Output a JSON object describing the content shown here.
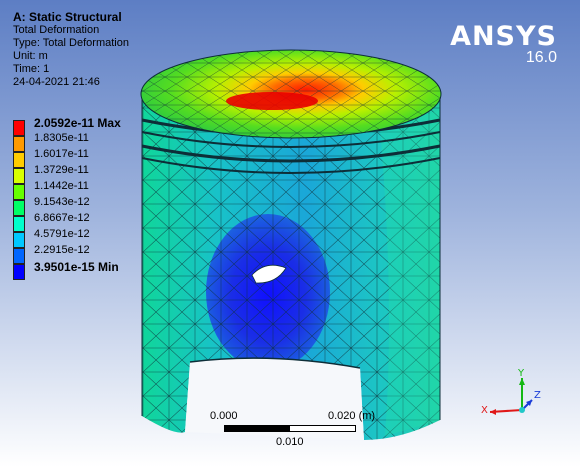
{
  "info": {
    "analysis_title": "A: Static Structural",
    "result_name": "Total Deformation",
    "type_line": "Type: Total Deformation",
    "unit_line": "Unit: m",
    "time_line": "Time: 1",
    "date_line": "24-04-2021 21:46"
  },
  "logo": {
    "brand": "ANSYS",
    "version": "16.0"
  },
  "legend": {
    "entries": [
      {
        "label": "2.0592e-11 Max",
        "color": "#ff0000",
        "emphasis": true
      },
      {
        "label": "1.8305e-11",
        "color": "#ff9a00",
        "emphasis": false
      },
      {
        "label": "1.6017e-11",
        "color": "#ffcc00",
        "emphasis": false
      },
      {
        "label": "1.3729e-11",
        "color": "#d9ff00",
        "emphasis": false
      },
      {
        "label": "1.1442e-11",
        "color": "#66ff00",
        "emphasis": false
      },
      {
        "label": "9.1543e-12",
        "color": "#00ff66",
        "emphasis": false
      },
      {
        "label": "6.8667e-12",
        "color": "#00ffcc",
        "emphasis": false
      },
      {
        "label": "4.5791e-12",
        "color": "#00c8ff",
        "emphasis": false
      },
      {
        "label": "2.2915e-12",
        "color": "#0066ff",
        "emphasis": false
      },
      {
        "label": "3.9501e-15 Min",
        "color": "#0000ff",
        "emphasis": true
      }
    ]
  },
  "scale": {
    "left_label": "0.000",
    "right_label": "0.020 (m)",
    "mid_label": "0.010"
  },
  "triad": {
    "x_label": "X",
    "y_label": "Y",
    "z_label": "Z"
  },
  "colors": {
    "bg_top": "#5d7ec4",
    "bg_bottom": "#ffffff",
    "mesh_line": "#0d2e38"
  }
}
